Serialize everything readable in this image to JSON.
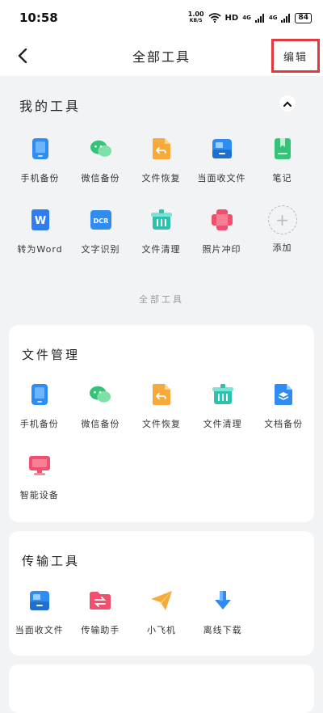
{
  "status": {
    "time": "10:58",
    "speed_value": "1.00",
    "speed_unit": "KB/S",
    "hd": "HD",
    "net1": "4G",
    "net2": "4G",
    "battery": "84"
  },
  "nav": {
    "title": "全部工具",
    "edit": "编辑"
  },
  "my_tools": {
    "title": "我的工具",
    "items": [
      {
        "label": "手机备份",
        "icon": "phone-backup-icon"
      },
      {
        "label": "微信备份",
        "icon": "wechat-backup-icon"
      },
      {
        "label": "文件恢复",
        "icon": "file-restore-icon"
      },
      {
        "label": "当面收文件",
        "icon": "receive-file-icon"
      },
      {
        "label": "笔记",
        "icon": "notes-icon"
      },
      {
        "label": "转为Word",
        "icon": "word-icon"
      },
      {
        "label": "文字识别",
        "icon": "ocr-icon"
      },
      {
        "label": "文件清理",
        "icon": "file-clean-icon"
      },
      {
        "label": "照片冲印",
        "icon": "photo-print-icon"
      },
      {
        "label": "添加",
        "icon": "add-icon"
      }
    ]
  },
  "divider": "全部工具",
  "file_management": {
    "title": "文件管理",
    "items": [
      {
        "label": "手机备份",
        "icon": "phone-backup-icon"
      },
      {
        "label": "微信备份",
        "icon": "wechat-backup-icon"
      },
      {
        "label": "文件恢复",
        "icon": "file-restore-icon"
      },
      {
        "label": "文件清理",
        "icon": "file-clean-icon"
      },
      {
        "label": "文档备份",
        "icon": "doc-backup-icon"
      },
      {
        "label": "智能设备",
        "icon": "smart-device-icon"
      }
    ]
  },
  "transfer_tools": {
    "title": "传输工具",
    "items": [
      {
        "label": "当面收文件",
        "icon": "receive-file-icon"
      },
      {
        "label": "传输助手",
        "icon": "transfer-assistant-icon"
      },
      {
        "label": "小飞机",
        "icon": "paper-plane-icon"
      },
      {
        "label": "离线下载",
        "icon": "offline-download-icon"
      }
    ]
  },
  "colors": {
    "accent_red": "#e0393e",
    "blue": "#2f8cf0",
    "green": "#35c37a",
    "orange": "#f7a93a",
    "pink": "#f0506e",
    "teal": "#2bc3b0"
  }
}
